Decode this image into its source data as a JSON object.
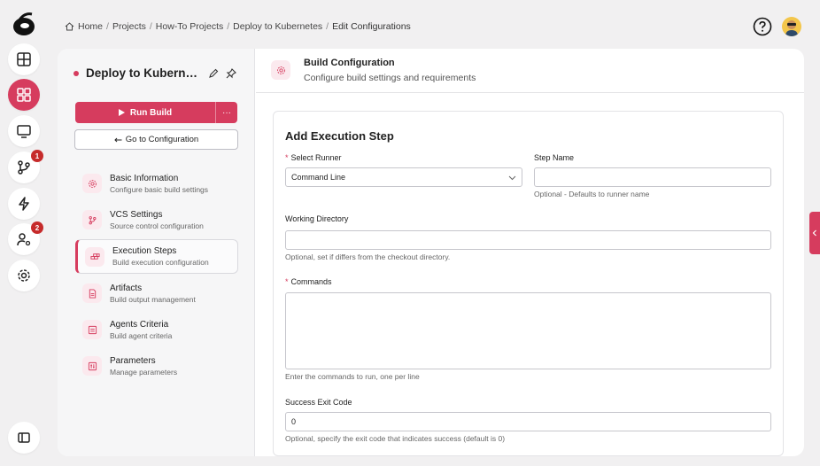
{
  "breadcrumb": {
    "items": [
      "Home",
      "Projects",
      "How-To Projects",
      "Deploy to Kubernetes",
      "Edit Configurations"
    ],
    "separator": "/"
  },
  "rail": {
    "badges": {
      "vcs": "1",
      "agents": "2"
    }
  },
  "project": {
    "name": "Deploy to Kubernetes"
  },
  "actions": {
    "run_build": "Run Build",
    "more": "···",
    "go_to_configuration": "Go to Configuration"
  },
  "nav": [
    {
      "title": "Basic Information",
      "subtitle": "Configure basic build settings",
      "icon": "gear-icon"
    },
    {
      "title": "VCS Settings",
      "subtitle": "Source control configuration",
      "icon": "branch-icon"
    },
    {
      "title": "Execution Steps",
      "subtitle": "Build execution configuration",
      "icon": "steps-icon"
    },
    {
      "title": "Artifacts",
      "subtitle": "Build output management",
      "icon": "file-icon"
    },
    {
      "title": "Agents Criteria",
      "subtitle": "Build agent criteria",
      "icon": "agent-icon"
    },
    {
      "title": "Parameters",
      "subtitle": "Manage parameters",
      "icon": "parameters-icon"
    }
  ],
  "header": {
    "title": "Build Configuration",
    "subtitle": "Configure build settings and requirements"
  },
  "form": {
    "title": "Add Execution Step",
    "runner_label": "Select Runner",
    "runner_value": "Command Line",
    "step_name_label": "Step Name",
    "step_name_hint": "Optional - Defaults to runner name",
    "working_dir_label": "Working Directory",
    "working_dir_hint": "Optional, set if differs from the checkout directory.",
    "commands_label": "Commands",
    "commands_hint": "Enter the commands to run, one per line",
    "exit_code_label": "Success Exit Code",
    "exit_code_value": "0",
    "exit_code_hint": "Optional, specify the exit code that indicates success (default is 0)"
  },
  "colors": {
    "accent": "#d63c5e",
    "accent_soft": "#fbe9ee",
    "background": "#f1f0f1"
  }
}
